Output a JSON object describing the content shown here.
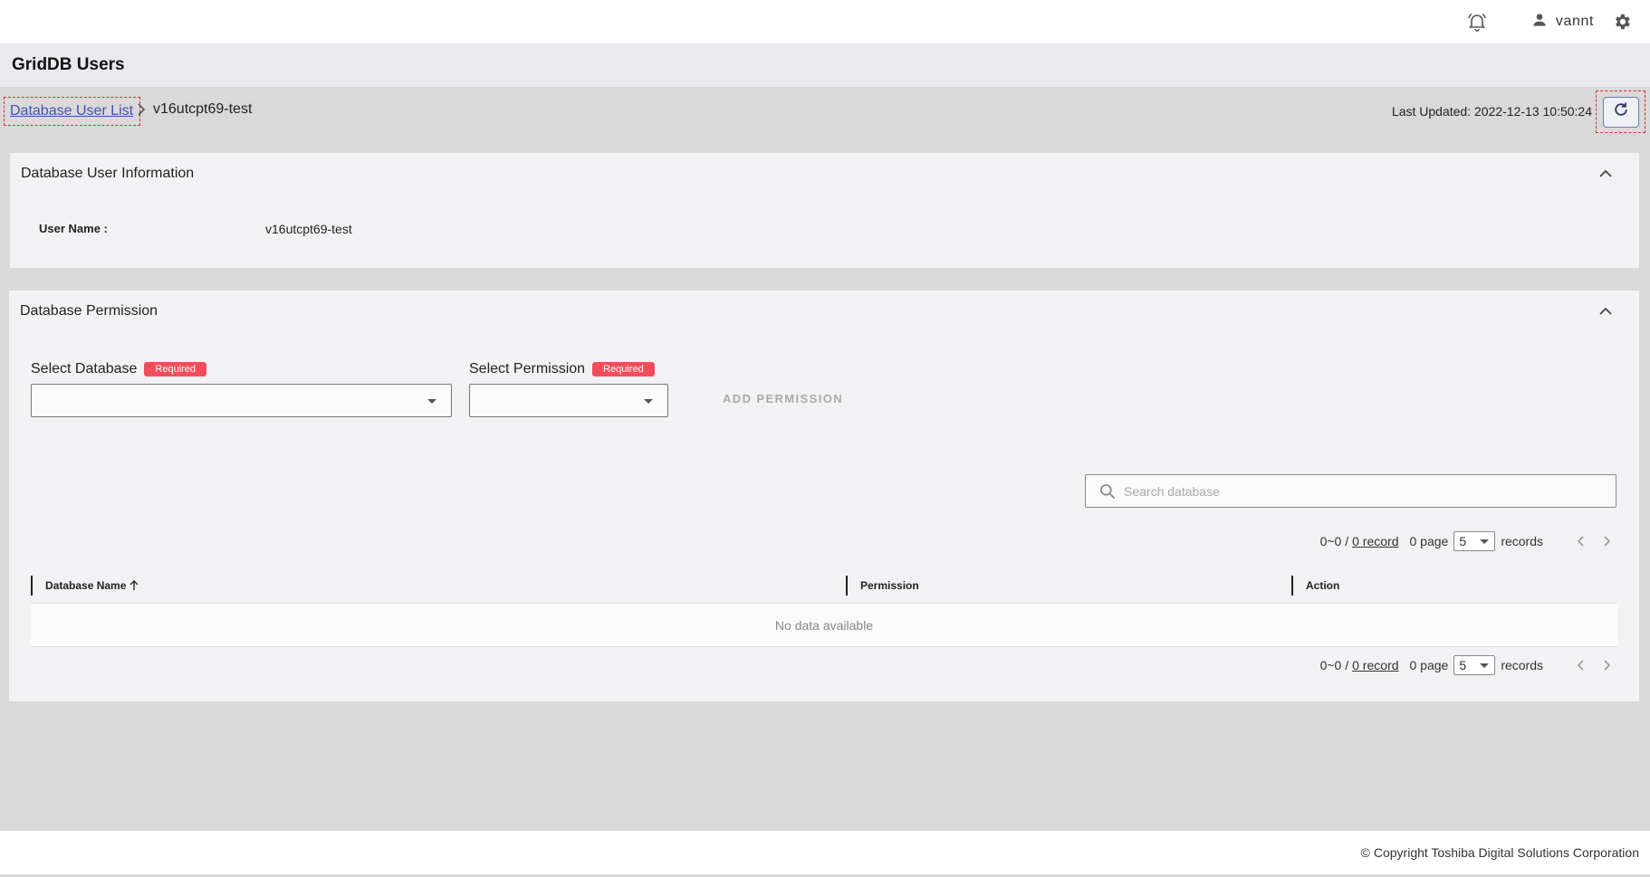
{
  "header": {
    "username": "vannt",
    "icons": {
      "notifications": "bell-icon",
      "user": "person-icon",
      "settings": "gear-icon"
    }
  },
  "page": {
    "title": "GridDB Users"
  },
  "breadcrumb": {
    "link": "Database User List",
    "current": "v16utcpt69-test"
  },
  "last_updated": "Last Updated: 2022-12-13 10:50:24",
  "user_info": {
    "title": "Database User Information",
    "user_name_label": "User Name :",
    "user_name_value": "v16utcpt69-test"
  },
  "permission": {
    "title": "Database Permission",
    "select_database_label": "Select Database",
    "select_permission_label": "Select Permission",
    "required_badge": "Required",
    "add_button": "ADD PERMISSION",
    "search_placeholder": "Search database",
    "pager": {
      "range": "0~0 /",
      "record_link": "0 record",
      "page_text": "0 page",
      "page_size": "5",
      "records_text": "records"
    },
    "table": {
      "columns": [
        "Database Name",
        "Permission",
        "Action"
      ],
      "empty_text": "No data available"
    }
  },
  "footer": {
    "copyright": "© Copyright Toshiba Digital Solutions Corporation"
  },
  "colors": {
    "required_badge": "#f44c5a",
    "link": "#3f51b5",
    "highlight_border": "#d32f2f"
  }
}
